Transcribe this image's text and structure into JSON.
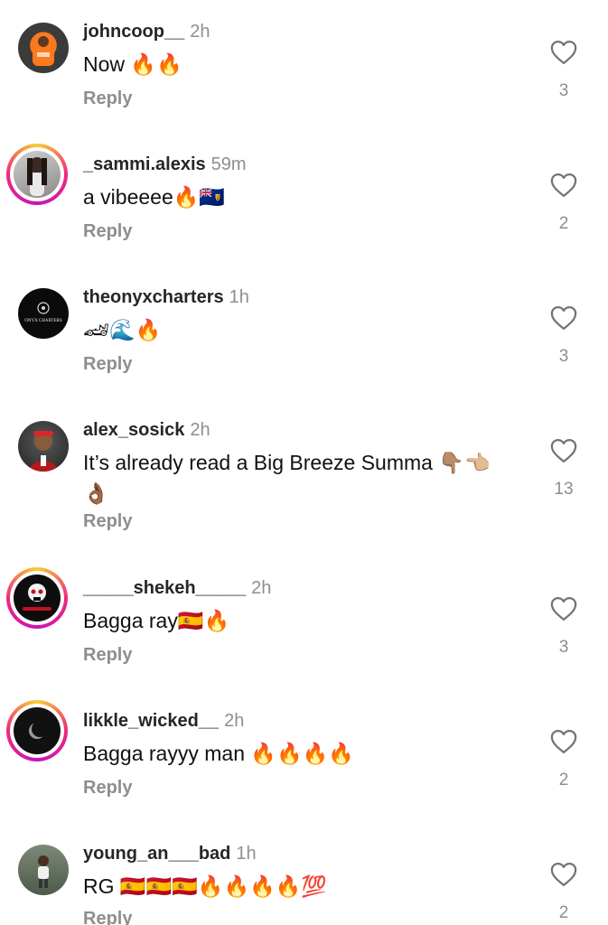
{
  "reply_label": "Reply",
  "comments": [
    {
      "username": "johncoop__",
      "time": "2h",
      "text": "Now 🔥🔥",
      "likes": "3"
    },
    {
      "username": "_sammi.alexis",
      "time": "59m",
      "text": "a vibeeee🔥🇹🇨",
      "likes": "2"
    },
    {
      "username": "theonyxcharters",
      "time": "1h",
      "text": "🏎🌊🔥",
      "likes": "3",
      "avatar_text": "ONYX CHARTERS"
    },
    {
      "username": "alex_sosick",
      "time": "2h",
      "text": "It’s already read a Big Breeze Summa 👇🏽👈🏼👌🏾",
      "likes": "13"
    },
    {
      "username": "_____shekeh_____",
      "time": "2h",
      "text": "Bagga ray🇪🇸🔥",
      "likes": "3"
    },
    {
      "username": "likkle_wicked__",
      "time": "2h",
      "text": "Bagga rayyy man 🔥🔥🔥🔥",
      "likes": "2"
    },
    {
      "username": "young_an___bad",
      "time": "1h",
      "text": "RG 🇪🇸🇪🇸🇪🇸🔥🔥🔥🔥💯",
      "likes": "2"
    }
  ]
}
